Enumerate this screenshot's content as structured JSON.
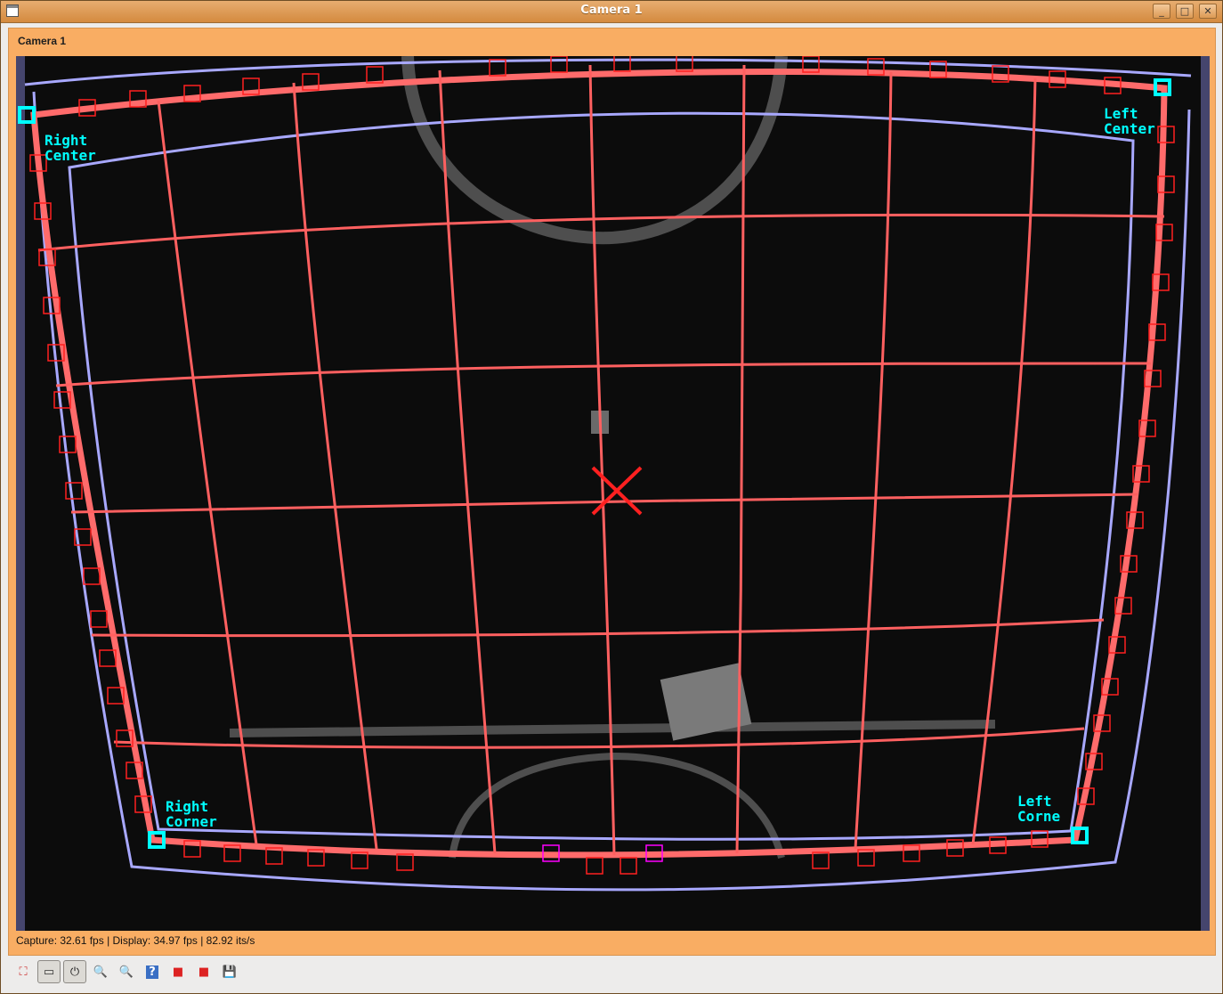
{
  "window": {
    "title": "Camera 1"
  },
  "panel": {
    "title": "Camera 1"
  },
  "overlay": {
    "label_right_center": [
      "Right",
      "Center"
    ],
    "label_left_center": [
      "Left",
      "Center"
    ],
    "label_right_corner": [
      "Right",
      "Corner"
    ],
    "label_left_corner": [
      "Left",
      "Corne"
    ]
  },
  "status": {
    "text": "Capture: 32.61 fps | Display: 34.97 fps | 82.92 its/s"
  },
  "toolbar": {
    "items": [
      {
        "name": "fullscreen-icon",
        "glyph": "⛶",
        "pressed": false
      },
      {
        "name": "window-icon",
        "glyph": "▭",
        "pressed": true
      },
      {
        "name": "power-icon",
        "glyph": "⏻",
        "pressed": true
      },
      {
        "name": "zoom-in-icon",
        "glyph": "🔍",
        "pressed": false
      },
      {
        "name": "zoom-out-icon",
        "glyph": "🔍",
        "pressed": false
      },
      {
        "name": "help-icon",
        "glyph": "?",
        "pressed": false
      },
      {
        "name": "record-icon",
        "glyph": "■",
        "pressed": false
      },
      {
        "name": "stop-record-icon",
        "glyph": "■",
        "pressed": false
      },
      {
        "name": "save-icon",
        "glyph": "💾",
        "pressed": false
      }
    ]
  },
  "colors": {
    "grid": "#ff6060",
    "outer": "#b0b0ff",
    "marker": "#00ffff",
    "target": "#ff2020"
  }
}
